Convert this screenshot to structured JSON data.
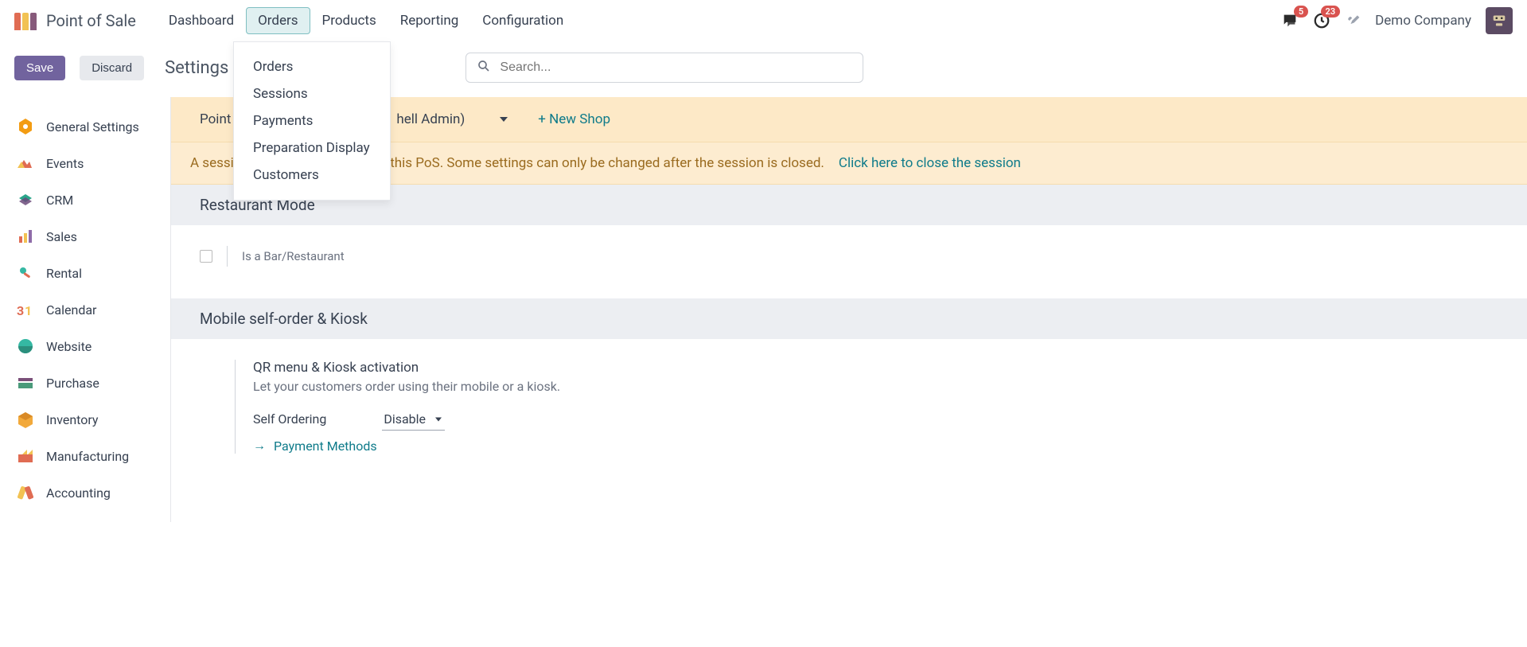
{
  "header": {
    "app_title": "Point of Sale",
    "nav": {
      "dashboard": "Dashboard",
      "orders": "Orders",
      "products": "Products",
      "reporting": "Reporting",
      "configuration": "Configuration"
    },
    "messages_badge": "5",
    "activities_badge": "23",
    "company": "Demo Company"
  },
  "orders_menu": {
    "orders": "Orders",
    "sessions": "Sessions",
    "payments": "Payments",
    "preparation_display": "Preparation Display",
    "customers": "Customers"
  },
  "controlbar": {
    "save": "Save",
    "discard": "Discard",
    "page_title": "Settings",
    "search_placeholder": "Search..."
  },
  "sidebar": {
    "items": [
      {
        "label": "General Settings"
      },
      {
        "label": "Events"
      },
      {
        "label": "CRM"
      },
      {
        "label": "Sales"
      },
      {
        "label": "Rental"
      },
      {
        "label": "Calendar"
      },
      {
        "label": "Website"
      },
      {
        "label": "Purchase"
      },
      {
        "label": "Inventory"
      },
      {
        "label": "Manufacturing"
      },
      {
        "label": "Accounting"
      }
    ]
  },
  "pos_bar": {
    "prefix": "Point",
    "suffix": "hell Admin)",
    "new_shop": "+ New Shop"
  },
  "warning": {
    "text": "A session is currently opened for this PoS. Some settings can only be changed after the session is closed.",
    "link": "Click here to close the session"
  },
  "sections": {
    "restaurant": {
      "title": "Restaurant Mode",
      "is_bar_label": "Is a Bar/Restaurant"
    },
    "kiosk": {
      "title": "Mobile self-order & Kiosk",
      "qr_title": "QR menu & Kiosk activation",
      "qr_desc": "Let your customers order using their mobile or a kiosk.",
      "self_ordering_label": "Self Ordering",
      "self_ordering_value": "Disable",
      "payment_methods": "Payment Methods"
    }
  }
}
